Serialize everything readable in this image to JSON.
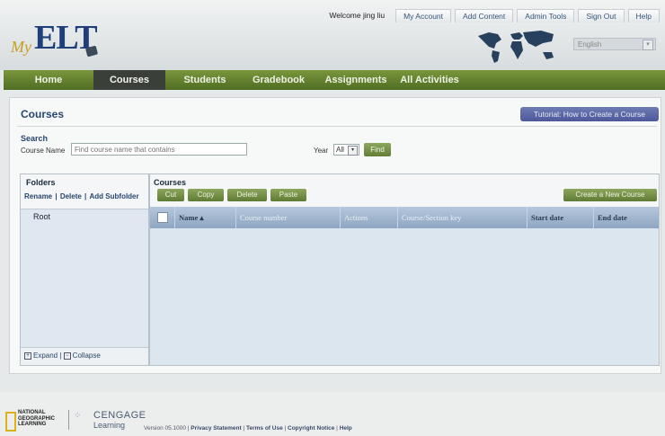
{
  "header": {
    "logo_my": "My",
    "logo_elt": "ELT",
    "welcome": "Welcome jing liu",
    "links": [
      "My Account",
      "Add Content",
      "Admin Tools",
      "Sign Out",
      "Help"
    ],
    "language": "English"
  },
  "nav": {
    "items": [
      {
        "label": "Home",
        "active": false
      },
      {
        "label": "Courses",
        "active": true
      },
      {
        "label": "Students",
        "active": false
      },
      {
        "label": "Gradebook",
        "active": false
      },
      {
        "label": "Assignments",
        "active": false
      },
      {
        "label": "All Activities",
        "active": false
      }
    ]
  },
  "page": {
    "title": "Courses",
    "tutorial_button": "Tutorial: How to Create a Course",
    "search_label": "Search",
    "course_name_label": "Course Name",
    "course_name_placeholder": "Find course name that contains",
    "year_label": "Year",
    "year_value": "All",
    "find_button": "Find"
  },
  "folders": {
    "title": "Folders",
    "rename": "Rename",
    "delete": "Delete",
    "add_subfolder": "Add Subfolder",
    "root": "Root",
    "expand": "Expand",
    "collapse": "Collapse"
  },
  "courses": {
    "title": "Courses",
    "buttons": {
      "cut": "Cut",
      "copy": "Copy",
      "delete": "Delete",
      "paste": "Paste",
      "create": "Create a New Course"
    },
    "columns": [
      "Name",
      "Course number",
      "Actions",
      "Course/Section key",
      "Start date",
      "End date"
    ]
  },
  "footer": {
    "ng_line1": "NATIONAL",
    "ng_line2": "GEOGRAPHIC",
    "ng_line3": "LEARNING",
    "cengage": "CENGAGE",
    "learning": "Learning",
    "version": "Version 05.1000",
    "privacy": "Privacy Statement",
    "terms": "Terms of Use",
    "copyright": "Copyright Notice",
    "help": "Help"
  },
  "colors": {
    "nav_green": "#5d7a2c",
    "nav_active": "#3b3f3a",
    "accent_blue": "#28466e",
    "button_green": "#6f8a40",
    "tutorial_purple": "#5a66a6"
  }
}
